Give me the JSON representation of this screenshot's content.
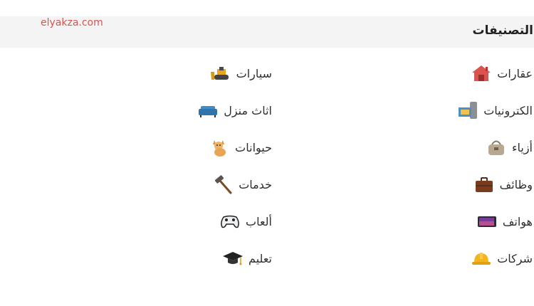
{
  "watermark": "elyakza.com",
  "section": {
    "title": "التصنيفات"
  },
  "categories": {
    "right": [
      {
        "label": "عقارات",
        "icon": "house-icon"
      },
      {
        "label": "الكترونيات",
        "icon": "electronics-icon"
      },
      {
        "label": "أزياء",
        "icon": "handbag-icon"
      },
      {
        "label": "وظائف",
        "icon": "briefcase-icon"
      },
      {
        "label": "هواتف",
        "icon": "phone-icon"
      },
      {
        "label": "شركات",
        "icon": "hard-hat-icon"
      }
    ],
    "left": [
      {
        "label": "سيارات",
        "icon": "bulldozer-icon"
      },
      {
        "label": "اثاث منزل",
        "icon": "sofa-icon"
      },
      {
        "label": "حيوانات",
        "icon": "cat-icon"
      },
      {
        "label": "خدمات",
        "icon": "hammer-icon"
      },
      {
        "label": "ألعاب",
        "icon": "gamepad-icon"
      },
      {
        "label": "تعليم",
        "icon": "graduation-cap-icon"
      }
    ]
  }
}
